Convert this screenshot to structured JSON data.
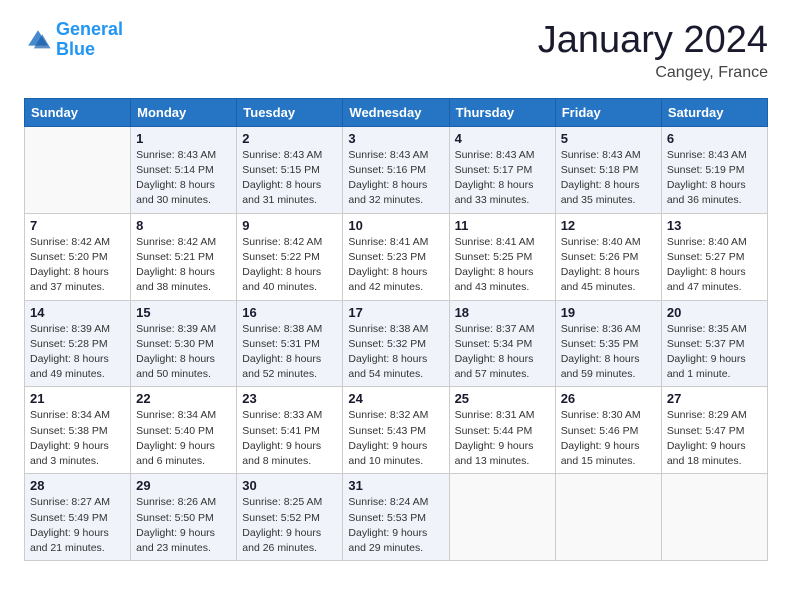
{
  "logo": {
    "line1": "General",
    "line2": "Blue"
  },
  "header": {
    "month": "January 2024",
    "location": "Cangey, France"
  },
  "columns": [
    "Sunday",
    "Monday",
    "Tuesday",
    "Wednesday",
    "Thursday",
    "Friday",
    "Saturday"
  ],
  "weeks": [
    [
      {
        "day": "",
        "detail": ""
      },
      {
        "day": "1",
        "detail": "Sunrise: 8:43 AM\nSunset: 5:14 PM\nDaylight: 8 hours\nand 30 minutes."
      },
      {
        "day": "2",
        "detail": "Sunrise: 8:43 AM\nSunset: 5:15 PM\nDaylight: 8 hours\nand 31 minutes."
      },
      {
        "day": "3",
        "detail": "Sunrise: 8:43 AM\nSunset: 5:16 PM\nDaylight: 8 hours\nand 32 minutes."
      },
      {
        "day": "4",
        "detail": "Sunrise: 8:43 AM\nSunset: 5:17 PM\nDaylight: 8 hours\nand 33 minutes."
      },
      {
        "day": "5",
        "detail": "Sunrise: 8:43 AM\nSunset: 5:18 PM\nDaylight: 8 hours\nand 35 minutes."
      },
      {
        "day": "6",
        "detail": "Sunrise: 8:43 AM\nSunset: 5:19 PM\nDaylight: 8 hours\nand 36 minutes."
      }
    ],
    [
      {
        "day": "7",
        "detail": "Sunrise: 8:42 AM\nSunset: 5:20 PM\nDaylight: 8 hours\nand 37 minutes."
      },
      {
        "day": "8",
        "detail": "Sunrise: 8:42 AM\nSunset: 5:21 PM\nDaylight: 8 hours\nand 38 minutes."
      },
      {
        "day": "9",
        "detail": "Sunrise: 8:42 AM\nSunset: 5:22 PM\nDaylight: 8 hours\nand 40 minutes."
      },
      {
        "day": "10",
        "detail": "Sunrise: 8:41 AM\nSunset: 5:23 PM\nDaylight: 8 hours\nand 42 minutes."
      },
      {
        "day": "11",
        "detail": "Sunrise: 8:41 AM\nSunset: 5:25 PM\nDaylight: 8 hours\nand 43 minutes."
      },
      {
        "day": "12",
        "detail": "Sunrise: 8:40 AM\nSunset: 5:26 PM\nDaylight: 8 hours\nand 45 minutes."
      },
      {
        "day": "13",
        "detail": "Sunrise: 8:40 AM\nSunset: 5:27 PM\nDaylight: 8 hours\nand 47 minutes."
      }
    ],
    [
      {
        "day": "14",
        "detail": "Sunrise: 8:39 AM\nSunset: 5:28 PM\nDaylight: 8 hours\nand 49 minutes."
      },
      {
        "day": "15",
        "detail": "Sunrise: 8:39 AM\nSunset: 5:30 PM\nDaylight: 8 hours\nand 50 minutes."
      },
      {
        "day": "16",
        "detail": "Sunrise: 8:38 AM\nSunset: 5:31 PM\nDaylight: 8 hours\nand 52 minutes."
      },
      {
        "day": "17",
        "detail": "Sunrise: 8:38 AM\nSunset: 5:32 PM\nDaylight: 8 hours\nand 54 minutes."
      },
      {
        "day": "18",
        "detail": "Sunrise: 8:37 AM\nSunset: 5:34 PM\nDaylight: 8 hours\nand 57 minutes."
      },
      {
        "day": "19",
        "detail": "Sunrise: 8:36 AM\nSunset: 5:35 PM\nDaylight: 8 hours\nand 59 minutes."
      },
      {
        "day": "20",
        "detail": "Sunrise: 8:35 AM\nSunset: 5:37 PM\nDaylight: 9 hours\nand 1 minute."
      }
    ],
    [
      {
        "day": "21",
        "detail": "Sunrise: 8:34 AM\nSunset: 5:38 PM\nDaylight: 9 hours\nand 3 minutes."
      },
      {
        "day": "22",
        "detail": "Sunrise: 8:34 AM\nSunset: 5:40 PM\nDaylight: 9 hours\nand 6 minutes."
      },
      {
        "day": "23",
        "detail": "Sunrise: 8:33 AM\nSunset: 5:41 PM\nDaylight: 9 hours\nand 8 minutes."
      },
      {
        "day": "24",
        "detail": "Sunrise: 8:32 AM\nSunset: 5:43 PM\nDaylight: 9 hours\nand 10 minutes."
      },
      {
        "day": "25",
        "detail": "Sunrise: 8:31 AM\nSunset: 5:44 PM\nDaylight: 9 hours\nand 13 minutes."
      },
      {
        "day": "26",
        "detail": "Sunrise: 8:30 AM\nSunset: 5:46 PM\nDaylight: 9 hours\nand 15 minutes."
      },
      {
        "day": "27",
        "detail": "Sunrise: 8:29 AM\nSunset: 5:47 PM\nDaylight: 9 hours\nand 18 minutes."
      }
    ],
    [
      {
        "day": "28",
        "detail": "Sunrise: 8:27 AM\nSunset: 5:49 PM\nDaylight: 9 hours\nand 21 minutes."
      },
      {
        "day": "29",
        "detail": "Sunrise: 8:26 AM\nSunset: 5:50 PM\nDaylight: 9 hours\nand 23 minutes."
      },
      {
        "day": "30",
        "detail": "Sunrise: 8:25 AM\nSunset: 5:52 PM\nDaylight: 9 hours\nand 26 minutes."
      },
      {
        "day": "31",
        "detail": "Sunrise: 8:24 AM\nSunset: 5:53 PM\nDaylight: 9 hours\nand 29 minutes."
      },
      {
        "day": "",
        "detail": ""
      },
      {
        "day": "",
        "detail": ""
      },
      {
        "day": "",
        "detail": ""
      }
    ]
  ]
}
